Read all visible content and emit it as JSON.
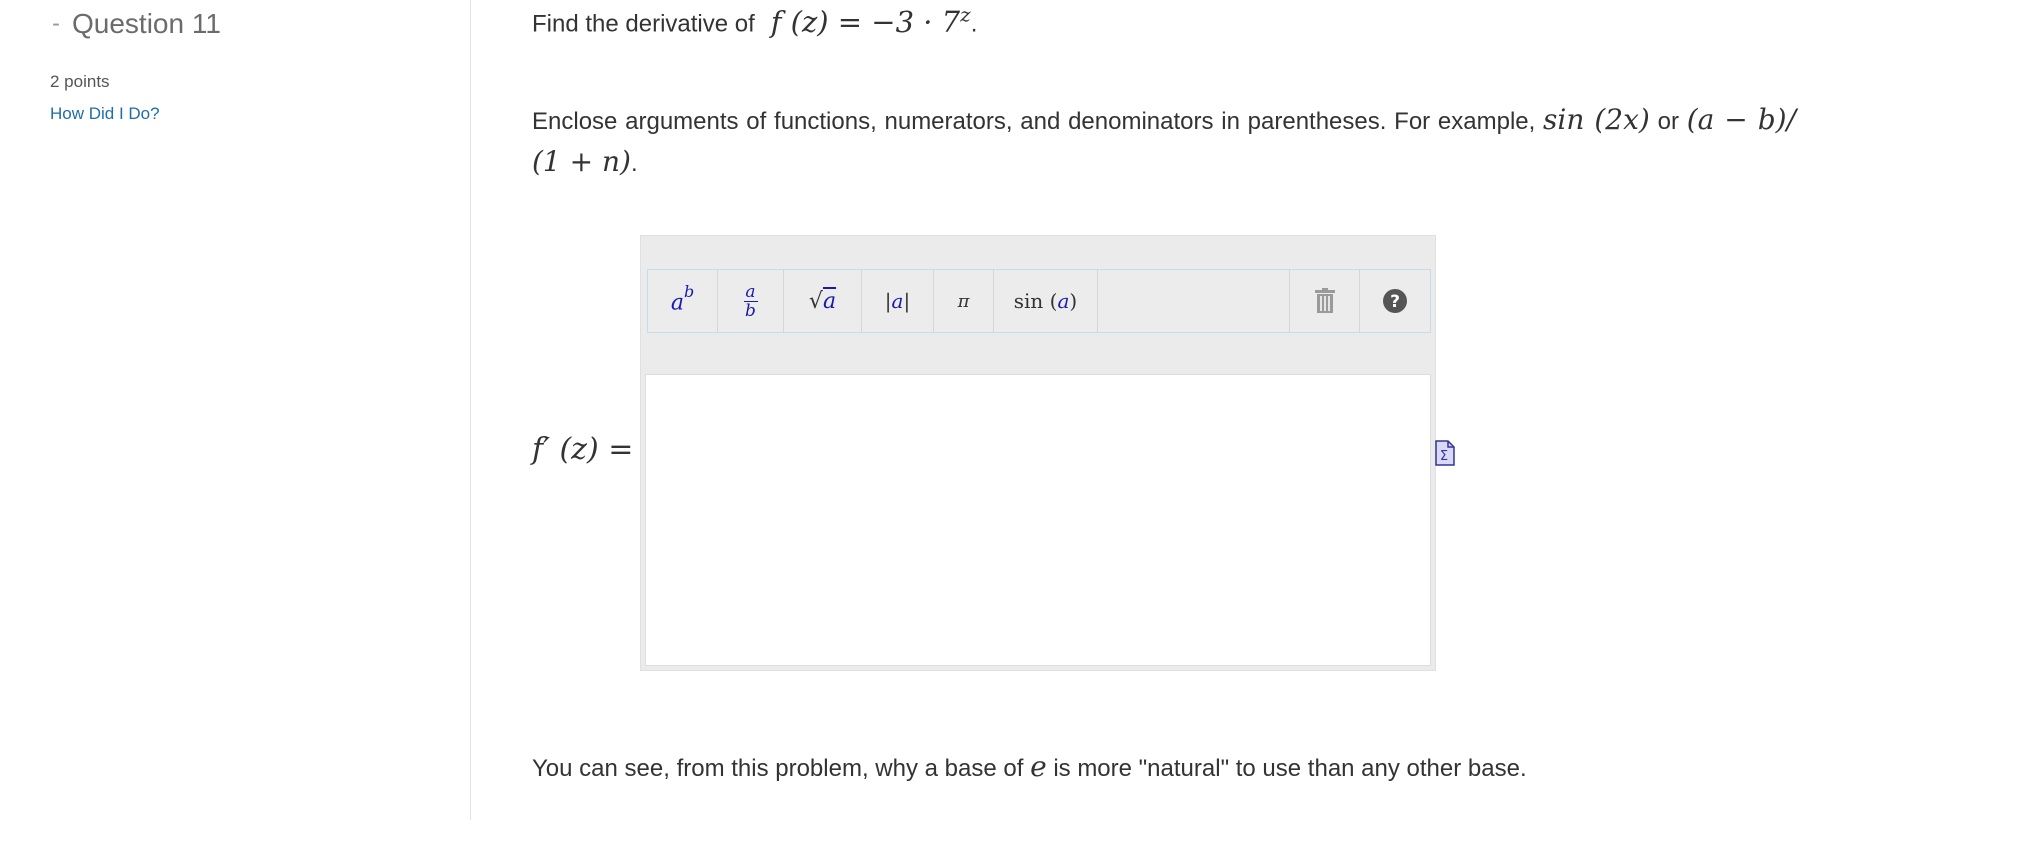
{
  "sidebar": {
    "collapse_symbol": "-",
    "question_title": "Question 11",
    "points": "2 points",
    "help_link": "How Did I Do?"
  },
  "question": {
    "prompt_text": "Find the derivative of",
    "function_expression": "f (z) = −3 · 7",
    "function_exponent": "z",
    "prompt_end": ".",
    "instructions_text": "Enclose arguments of functions, numerators, and denominators in parentheses. For example,",
    "example_one": "sin (2x)",
    "connector": "or",
    "example_two": "(a − b)/ (1 + n)",
    "example_end": "."
  },
  "editor": {
    "answer_label": "f′ (z) =",
    "answer_value": "",
    "toolbar": [
      {
        "name": "power-button",
        "label": "a^b",
        "icon": "power-icon"
      },
      {
        "name": "fraction-button",
        "label": "a/b",
        "icon": "fraction-icon"
      },
      {
        "name": "sqrt-button",
        "label": "√a",
        "icon": "sqrt-icon"
      },
      {
        "name": "abs-button",
        "label": "|a|",
        "icon": "abs-icon"
      },
      {
        "name": "pi-button",
        "label": "π",
        "icon": "pi-icon"
      },
      {
        "name": "sin-button",
        "label": "sin (a)",
        "icon": "sin-icon"
      },
      {
        "name": "clear-button",
        "label": "",
        "icon": "trash-icon"
      },
      {
        "name": "help-button",
        "label": "",
        "icon": "help-icon"
      }
    ]
  },
  "note": {
    "before": "You can see, from this problem, why a base of",
    "symbol": "e",
    "after": "is more \"natural\" to use than any other base."
  },
  "colors": {
    "link": "#1f6ea8",
    "toolbar_symbol": "#1a1ab0",
    "divider": "#e2e2e2",
    "editor_bg": "#ebebeb"
  }
}
